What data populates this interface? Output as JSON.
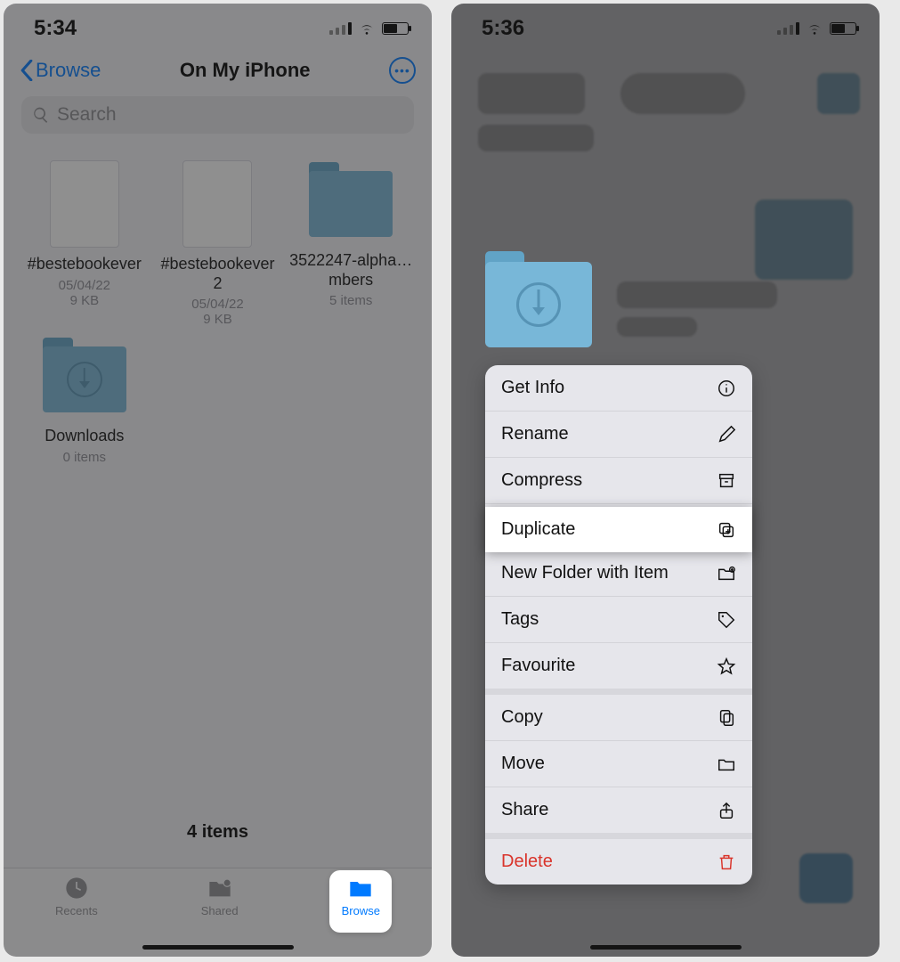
{
  "left": {
    "status": {
      "time": "5:34"
    },
    "header": {
      "back_label": "Browse",
      "title": "On My iPhone"
    },
    "search": {
      "placeholder": "Search"
    },
    "items": [
      {
        "name": "#bestebookever",
        "date": "05/04/22",
        "size": "9 KB",
        "kind": "file"
      },
      {
        "name": "#bestebookever 2",
        "date": "05/04/22",
        "size": "9 KB",
        "kind": "file"
      },
      {
        "name": "3522247-alpha…mbers",
        "meta": "5 items",
        "kind": "folder"
      },
      {
        "name": "Downloads",
        "meta": "0 items",
        "kind": "folder-dl"
      }
    ],
    "footer_count": "4 items",
    "tabs": {
      "recents": "Recents",
      "shared": "Shared",
      "browse": "Browse"
    }
  },
  "right": {
    "status": {
      "time": "5:36"
    },
    "menu": {
      "group1": [
        {
          "label": "Get Info",
          "icon": "info-icon"
        },
        {
          "label": "Rename",
          "icon": "pencil-icon"
        },
        {
          "label": "Compress",
          "icon": "archive-icon"
        },
        {
          "label": "Duplicate",
          "icon": "duplicate-icon"
        },
        {
          "label": "New Folder with Item",
          "icon": "folder-plus-icon"
        },
        {
          "label": "Tags",
          "icon": "tag-icon"
        },
        {
          "label": "Favourite",
          "icon": "star-icon"
        }
      ],
      "group2": [
        {
          "label": "Copy",
          "icon": "copy-icon"
        },
        {
          "label": "Move",
          "icon": "folder-icon"
        },
        {
          "label": "Share",
          "icon": "share-icon"
        }
      ],
      "group3": [
        {
          "label": "Delete",
          "icon": "trash-icon"
        }
      ]
    }
  }
}
